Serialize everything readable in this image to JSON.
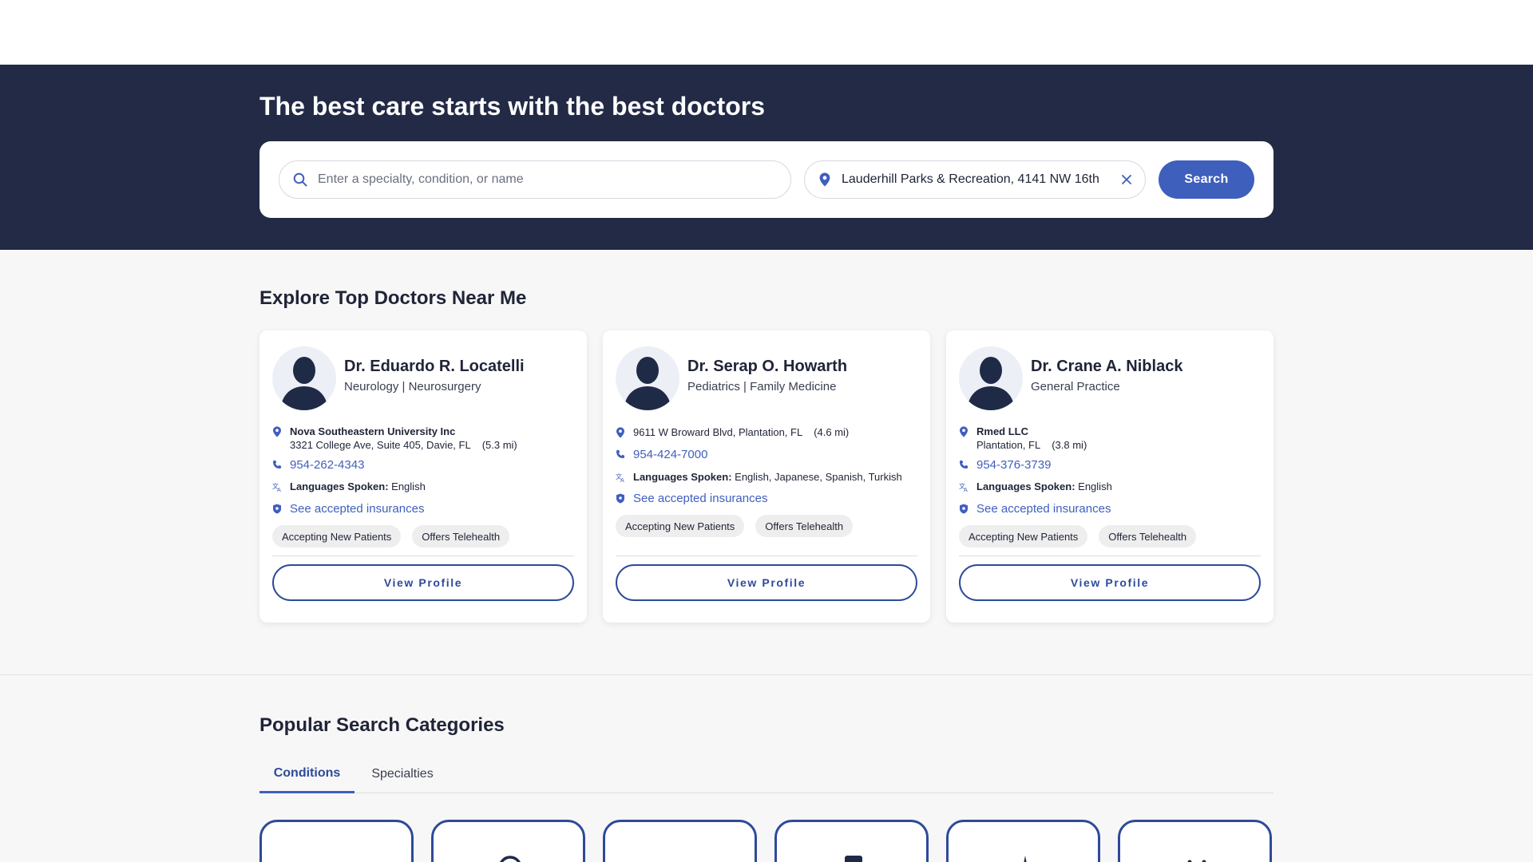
{
  "hero": {
    "title": "The best care starts with the best doctors",
    "query_placeholder": "Enter a specialty, condition, or name",
    "location_value": "Lauderhill Parks & Recreation, 4141 NW 16th",
    "search_label": "Search"
  },
  "explore": {
    "title": "Explore Top Doctors Near Me",
    "doctors": [
      {
        "name": "Dr. Eduardo R. Locatelli",
        "specialty": "Neurology | Neurosurgery",
        "facility": "Nova Southeastern University Inc",
        "address": "3321 College Ave, Suite 405, Davie, FL",
        "distance": "(5.3 mi)",
        "phone": "954-262-4343",
        "languages_label": "Languages Spoken:",
        "languages": "English",
        "insurance_link": "See accepted insurances",
        "badges": [
          "Accepting New Patients",
          "Offers Telehealth"
        ],
        "button": "View Profile"
      },
      {
        "name": "Dr. Serap O. Howarth",
        "specialty": "Pediatrics | Family Medicine",
        "facility": "",
        "address": "9611 W Broward Blvd, Plantation, FL",
        "distance": "(4.6 mi)",
        "phone": "954-424-7000",
        "languages_label": "Languages Spoken:",
        "languages": "English, Japanese, Spanish, Turkish",
        "insurance_link": "See accepted insurances",
        "badges": [
          "Accepting New Patients",
          "Offers Telehealth"
        ],
        "button": "View Profile"
      },
      {
        "name": "Dr. Crane A. Niblack",
        "specialty": "General Practice",
        "facility": "Rmed LLC",
        "address": "Plantation, FL",
        "distance": "(3.8 mi)",
        "phone": "954-376-3739",
        "languages_label": "Languages Spoken:",
        "languages": "English",
        "insurance_link": "See accepted insurances",
        "badges": [
          "Accepting New Patients",
          "Offers Telehealth"
        ],
        "button": "View Profile"
      }
    ]
  },
  "categories": {
    "title": "Popular Search Categories",
    "tabs": [
      {
        "label": "Conditions",
        "active": true
      },
      {
        "label": "Specialties",
        "active": false
      }
    ],
    "tile_icons": [
      "blank-icon",
      "brain-icon",
      "blank-icon",
      "clipboard-icon",
      "body-icon",
      "joint-icon"
    ]
  },
  "colors": {
    "hero_bg": "#222a45",
    "accent": "#3f5fbd",
    "accent_dark": "#2d4a9a",
    "page_bg": "#f7f7f7"
  }
}
